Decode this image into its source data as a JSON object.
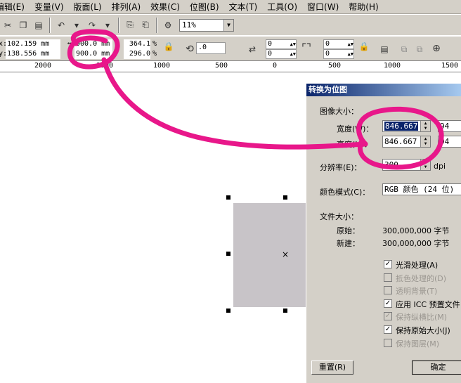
{
  "menu": [
    "编辑(E)",
    "变量(V)",
    "版面(L)",
    "排列(A)",
    "效果(C)",
    "位图(B)",
    "文本(T)",
    "工具(O)",
    "窗口(W)",
    "帮助(H)"
  ],
  "toolbar": {
    "zoom": "11%"
  },
  "props": {
    "x": "102.159 mm",
    "y": "138.556 mm",
    "w": "900.0 mm",
    "h": "900.0 mm",
    "sx": "364.1",
    "sy": "296.0",
    "pct": "%",
    "angle": ".0",
    "n1": "0",
    "n2": "0",
    "n3": "0",
    "n4": "0"
  },
  "ruler": {
    "labels": [
      "2000",
      "1500",
      "1000",
      "500",
      "0",
      "500",
      "1000",
      "1500"
    ]
  },
  "dialog": {
    "title": "转换为位图",
    "image_size": "图像大小：",
    "width_label": "宽度(W)：",
    "width_value": "846.667",
    "width_extra": "94",
    "height_label": "高度(H)：",
    "height_value": "846.667",
    "height_extra": "94",
    "resolution_label": "分辨率(E)：",
    "resolution_value": "300",
    "resolution_unit": "dpi",
    "color_mode_label": "颜色模式(C)：",
    "color_mode_value": "RGB 颜色 (24 位)",
    "file_size_label": "文件大小：",
    "original_label": "原始：",
    "original_value": "300,000,000 字节",
    "new_label": "新建：",
    "new_value": "300,000,000 字节",
    "opts": [
      {
        "label": "光滑处理(A)",
        "checked": true,
        "disabled": false
      },
      {
        "label": "抵色处理的(D)",
        "checked": false,
        "disabled": true
      },
      {
        "label": "透明背景(T)",
        "checked": false,
        "disabled": true
      },
      {
        "label": "应用 ICC 预置文件",
        "checked": true,
        "disabled": false
      },
      {
        "label": "保持纵横比(M)",
        "checked": true,
        "disabled": true
      },
      {
        "label": "保持原始大小(J)",
        "checked": true,
        "disabled": false
      },
      {
        "label": "保持图层(M)",
        "checked": false,
        "disabled": true
      }
    ],
    "reset": "重置(R)",
    "ok": "确定"
  },
  "colors": {
    "annotation": "#e8178a",
    "titlebar": "#0a246a",
    "rect": "#c8c4c8"
  }
}
